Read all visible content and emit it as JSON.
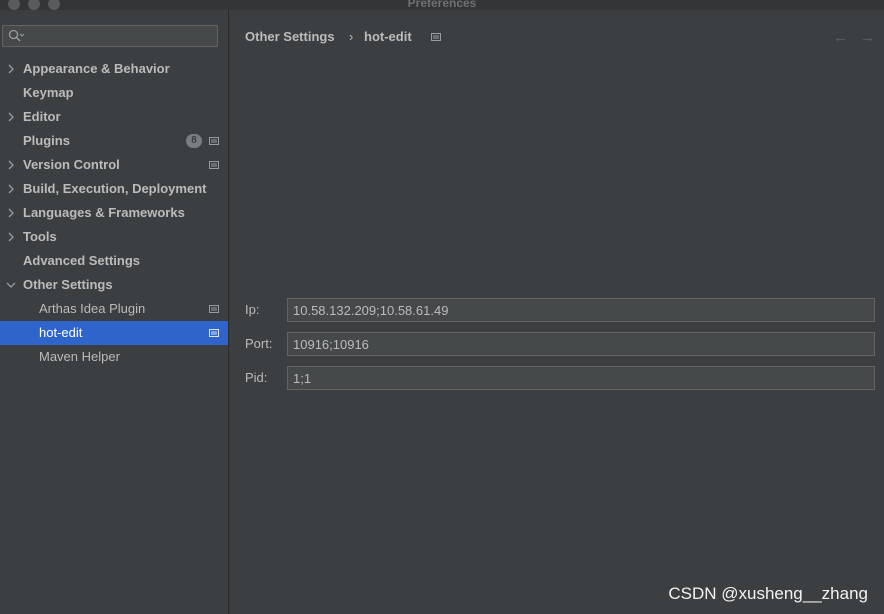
{
  "window": {
    "title": "Preferences"
  },
  "sidebar": {
    "search_placeholder": "",
    "items": [
      {
        "label": "Appearance & Behavior",
        "expandable": true
      },
      {
        "label": "Keymap",
        "expandable": false
      },
      {
        "label": "Editor",
        "expandable": true
      },
      {
        "label": "Plugins",
        "expandable": false,
        "badge": "8"
      },
      {
        "label": "Version Control",
        "expandable": true
      },
      {
        "label": "Build, Execution, Deployment",
        "expandable": true
      },
      {
        "label": "Languages & Frameworks",
        "expandable": true
      },
      {
        "label": "Tools",
        "expandable": true
      },
      {
        "label": "Advanced Settings",
        "expandable": false
      },
      {
        "label": "Other Settings",
        "expandable": true,
        "expanded": true
      },
      {
        "label": "Arthas Idea Plugin",
        "child": true
      },
      {
        "label": "hot-edit",
        "child": true,
        "selected": true
      },
      {
        "label": "Maven Helper",
        "child": true
      }
    ]
  },
  "breadcrumb": {
    "parent": "Other Settings",
    "separator": "›",
    "current": "hot-edit"
  },
  "form": {
    "ip": {
      "label": "Ip:",
      "value": "10.58.132.209;10.58.61.49"
    },
    "port": {
      "label": "Port:",
      "value": "10916;10916"
    },
    "pid": {
      "label": "Pid:",
      "value": "1;1"
    }
  },
  "nav": {
    "back": "←",
    "forward": "→"
  },
  "watermark": "CSDN @xusheng__zhang",
  "colors": {
    "selection": "#2f65ca",
    "background": "#3c3f41"
  }
}
